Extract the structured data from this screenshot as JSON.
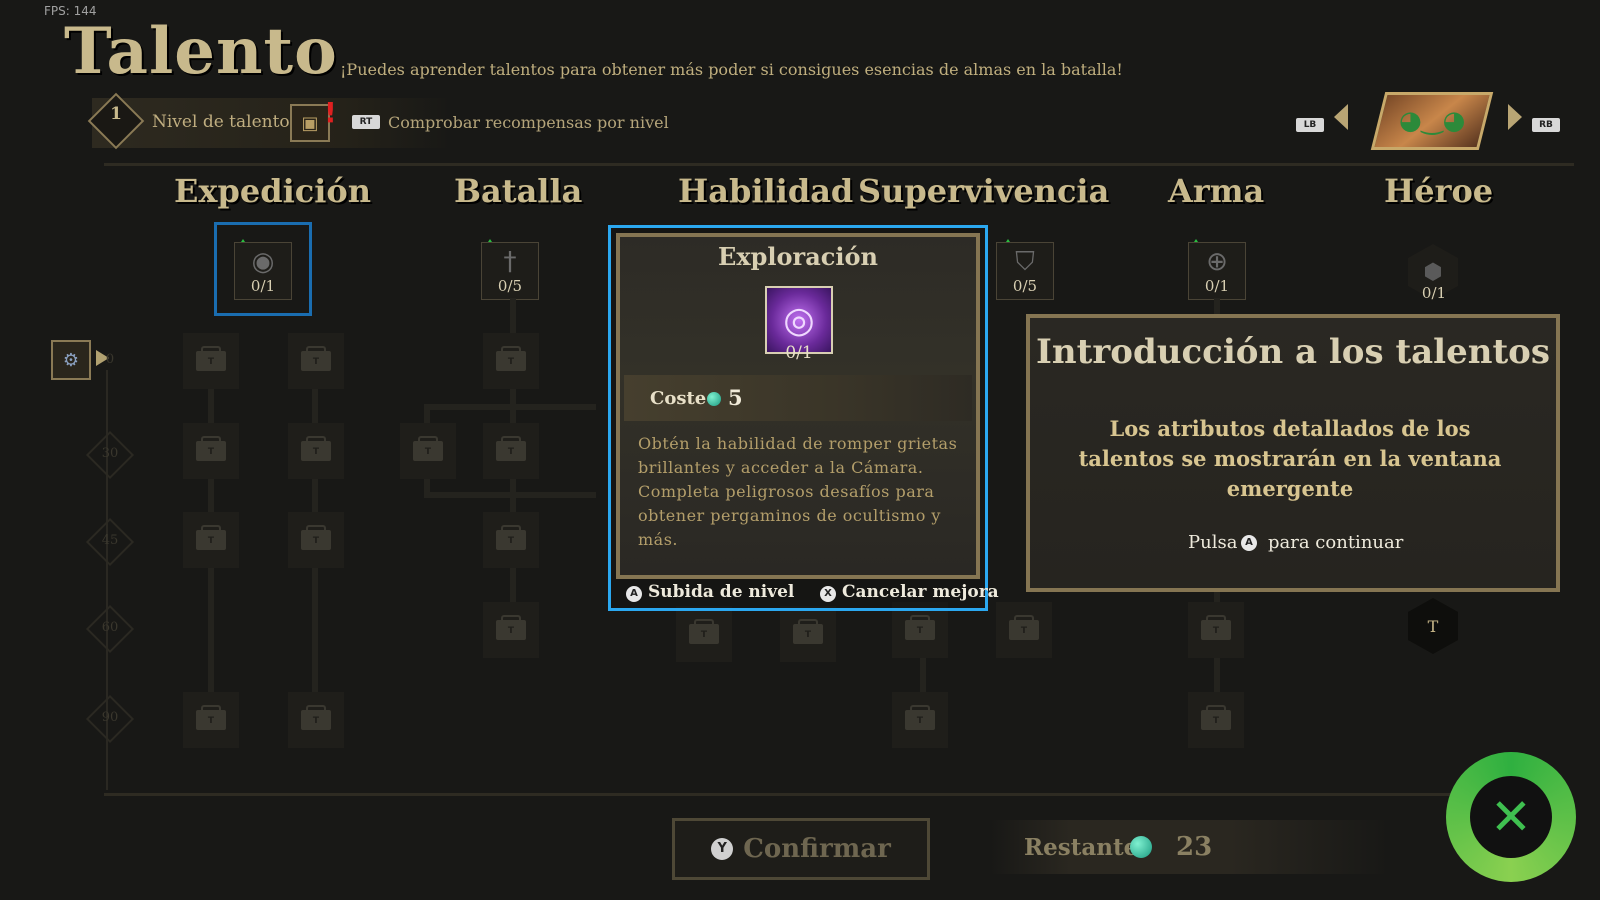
{
  "fps": "FPS: 144",
  "header": {
    "title": "Talento",
    "subtitle": "¡Puedes aprender talentos para obtener más poder si consigues esencias de almas en la batalla!",
    "talent_level": "1",
    "talent_level_label": "Nivel de talento",
    "alert": "!",
    "rt_button": "RT",
    "check_rewards": "Comprobar recompensas por nivel",
    "lb_button": "LB",
    "rb_button": "RB"
  },
  "columns": [
    {
      "label": "Expedición",
      "count": "0/1",
      "icon": "swirl-icon"
    },
    {
      "label": "Batalla",
      "count": "0/5",
      "icon": "sword-icon"
    },
    {
      "label": "Habilidad",
      "count": "",
      "icon": ""
    },
    {
      "label": "Supervivencia",
      "count": "0/5",
      "icon": "shield-icon"
    },
    {
      "label": "Arma",
      "count": "0/1",
      "icon": "crosshair-icon"
    },
    {
      "label": "Héroe",
      "count": "0/1",
      "icon": "hex-icon"
    }
  ],
  "row_levels": [
    "0",
    "30",
    "45",
    "60",
    "90"
  ],
  "lock_label": "T",
  "popup": {
    "title": "Exploración",
    "count": "0/1",
    "cost_label": "Coste",
    "cost_value": "5",
    "description": "Obtén la habilidad de romper grietas brillantes y acceder a la Cámara. Completa peligrosos desafíos para obtener pergaminos de ocultismo y más.",
    "level_up_button": "A",
    "level_up_label": "Subida de nivel",
    "cancel_button": "X",
    "cancel_label": "Cancelar mejora"
  },
  "intro": {
    "title": "Introducción a los talentos",
    "text": "Los atributos detallados de los talentos se mostrarán en la ventana emergente",
    "press_label": "Pulsa",
    "press_button": "A",
    "continue_label": "para continuar"
  },
  "footer": {
    "confirm_button": "Y",
    "confirm_label": "Confirmar",
    "remaining_label": "Restante:",
    "remaining_value": "23"
  },
  "colors": {
    "accent_gold": "#c8b98c",
    "selection_blue": "#2ba8f0",
    "upgrade_green": "#2ac040",
    "gem_teal": "#1a9a80"
  }
}
